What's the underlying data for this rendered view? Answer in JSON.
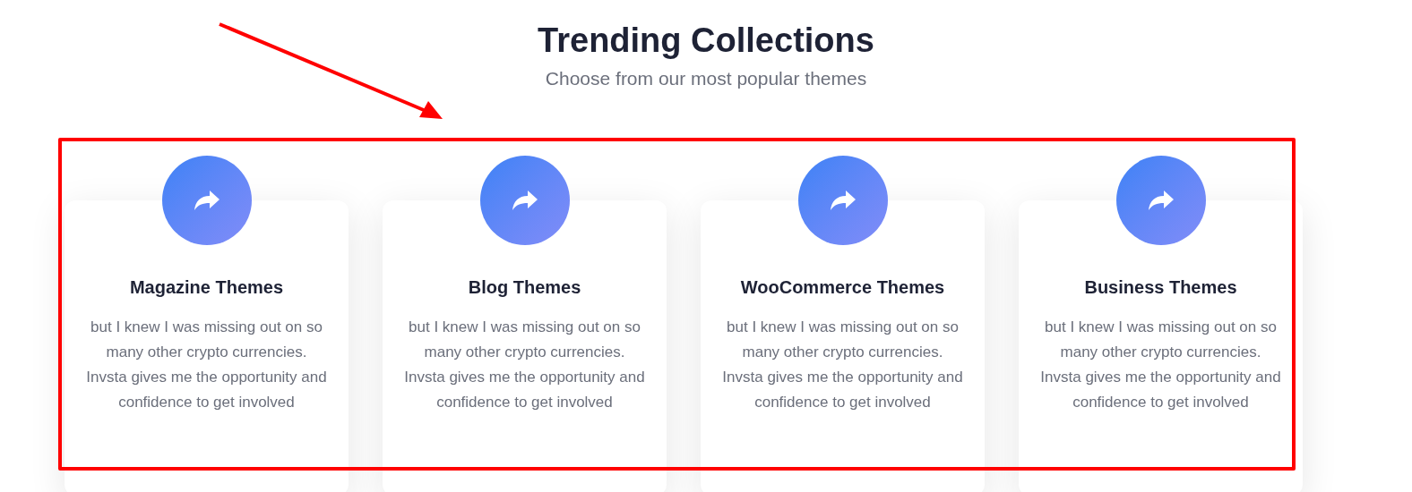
{
  "header": {
    "title": "Trending Collections",
    "subtitle": "Choose from our most popular themes"
  },
  "cards": [
    {
      "title": "Magazine Themes",
      "text": "but I knew I was missing out on so many other crypto currencies. Invsta gives me the opportunity and confidence to get involved"
    },
    {
      "title": "Blog Themes",
      "text": "but I knew I was missing out on so many other crypto currencies. Invsta gives me the opportunity and confidence to get involved"
    },
    {
      "title": "WooCommerce Themes",
      "text": "but I knew I was missing out on so many other crypto currencies. Invsta gives me the opportunity and confidence to get involved"
    },
    {
      "title": "Business Themes",
      "text": "but I knew I was missing out on so many other crypto currencies. Invsta gives me the opportunity and confidence to get involved"
    }
  ]
}
